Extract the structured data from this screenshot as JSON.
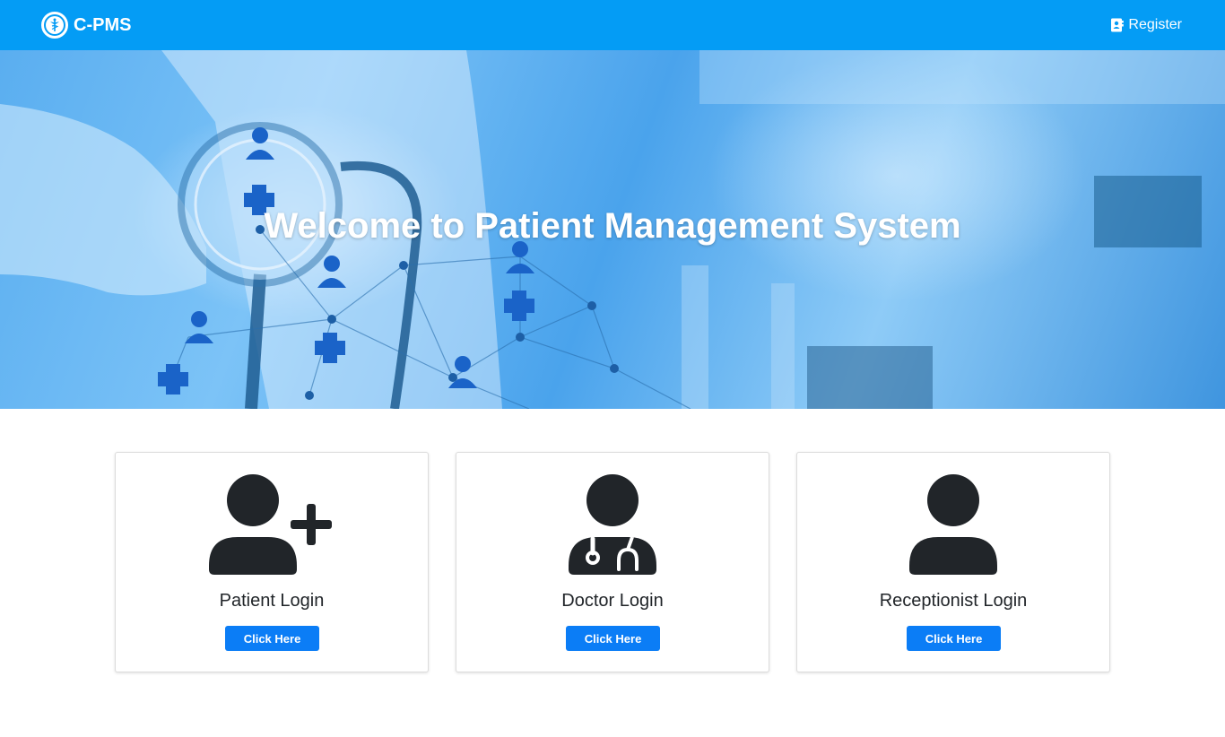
{
  "navbar": {
    "brand": "C-PMS",
    "register_label": "Register"
  },
  "hero": {
    "title": "Welcome to Patient Management System"
  },
  "cards": [
    {
      "title": "Patient Login",
      "button": "Click Here",
      "icon": "user-plus-icon"
    },
    {
      "title": "Doctor Login",
      "button": "Click Here",
      "icon": "user-doctor-icon"
    },
    {
      "title": "Receptionist Login",
      "button": "Click Here",
      "icon": "user-icon"
    }
  ],
  "colors": {
    "navbar": "#049cf5",
    "button": "#0b7df6",
    "icon": "#212529"
  }
}
